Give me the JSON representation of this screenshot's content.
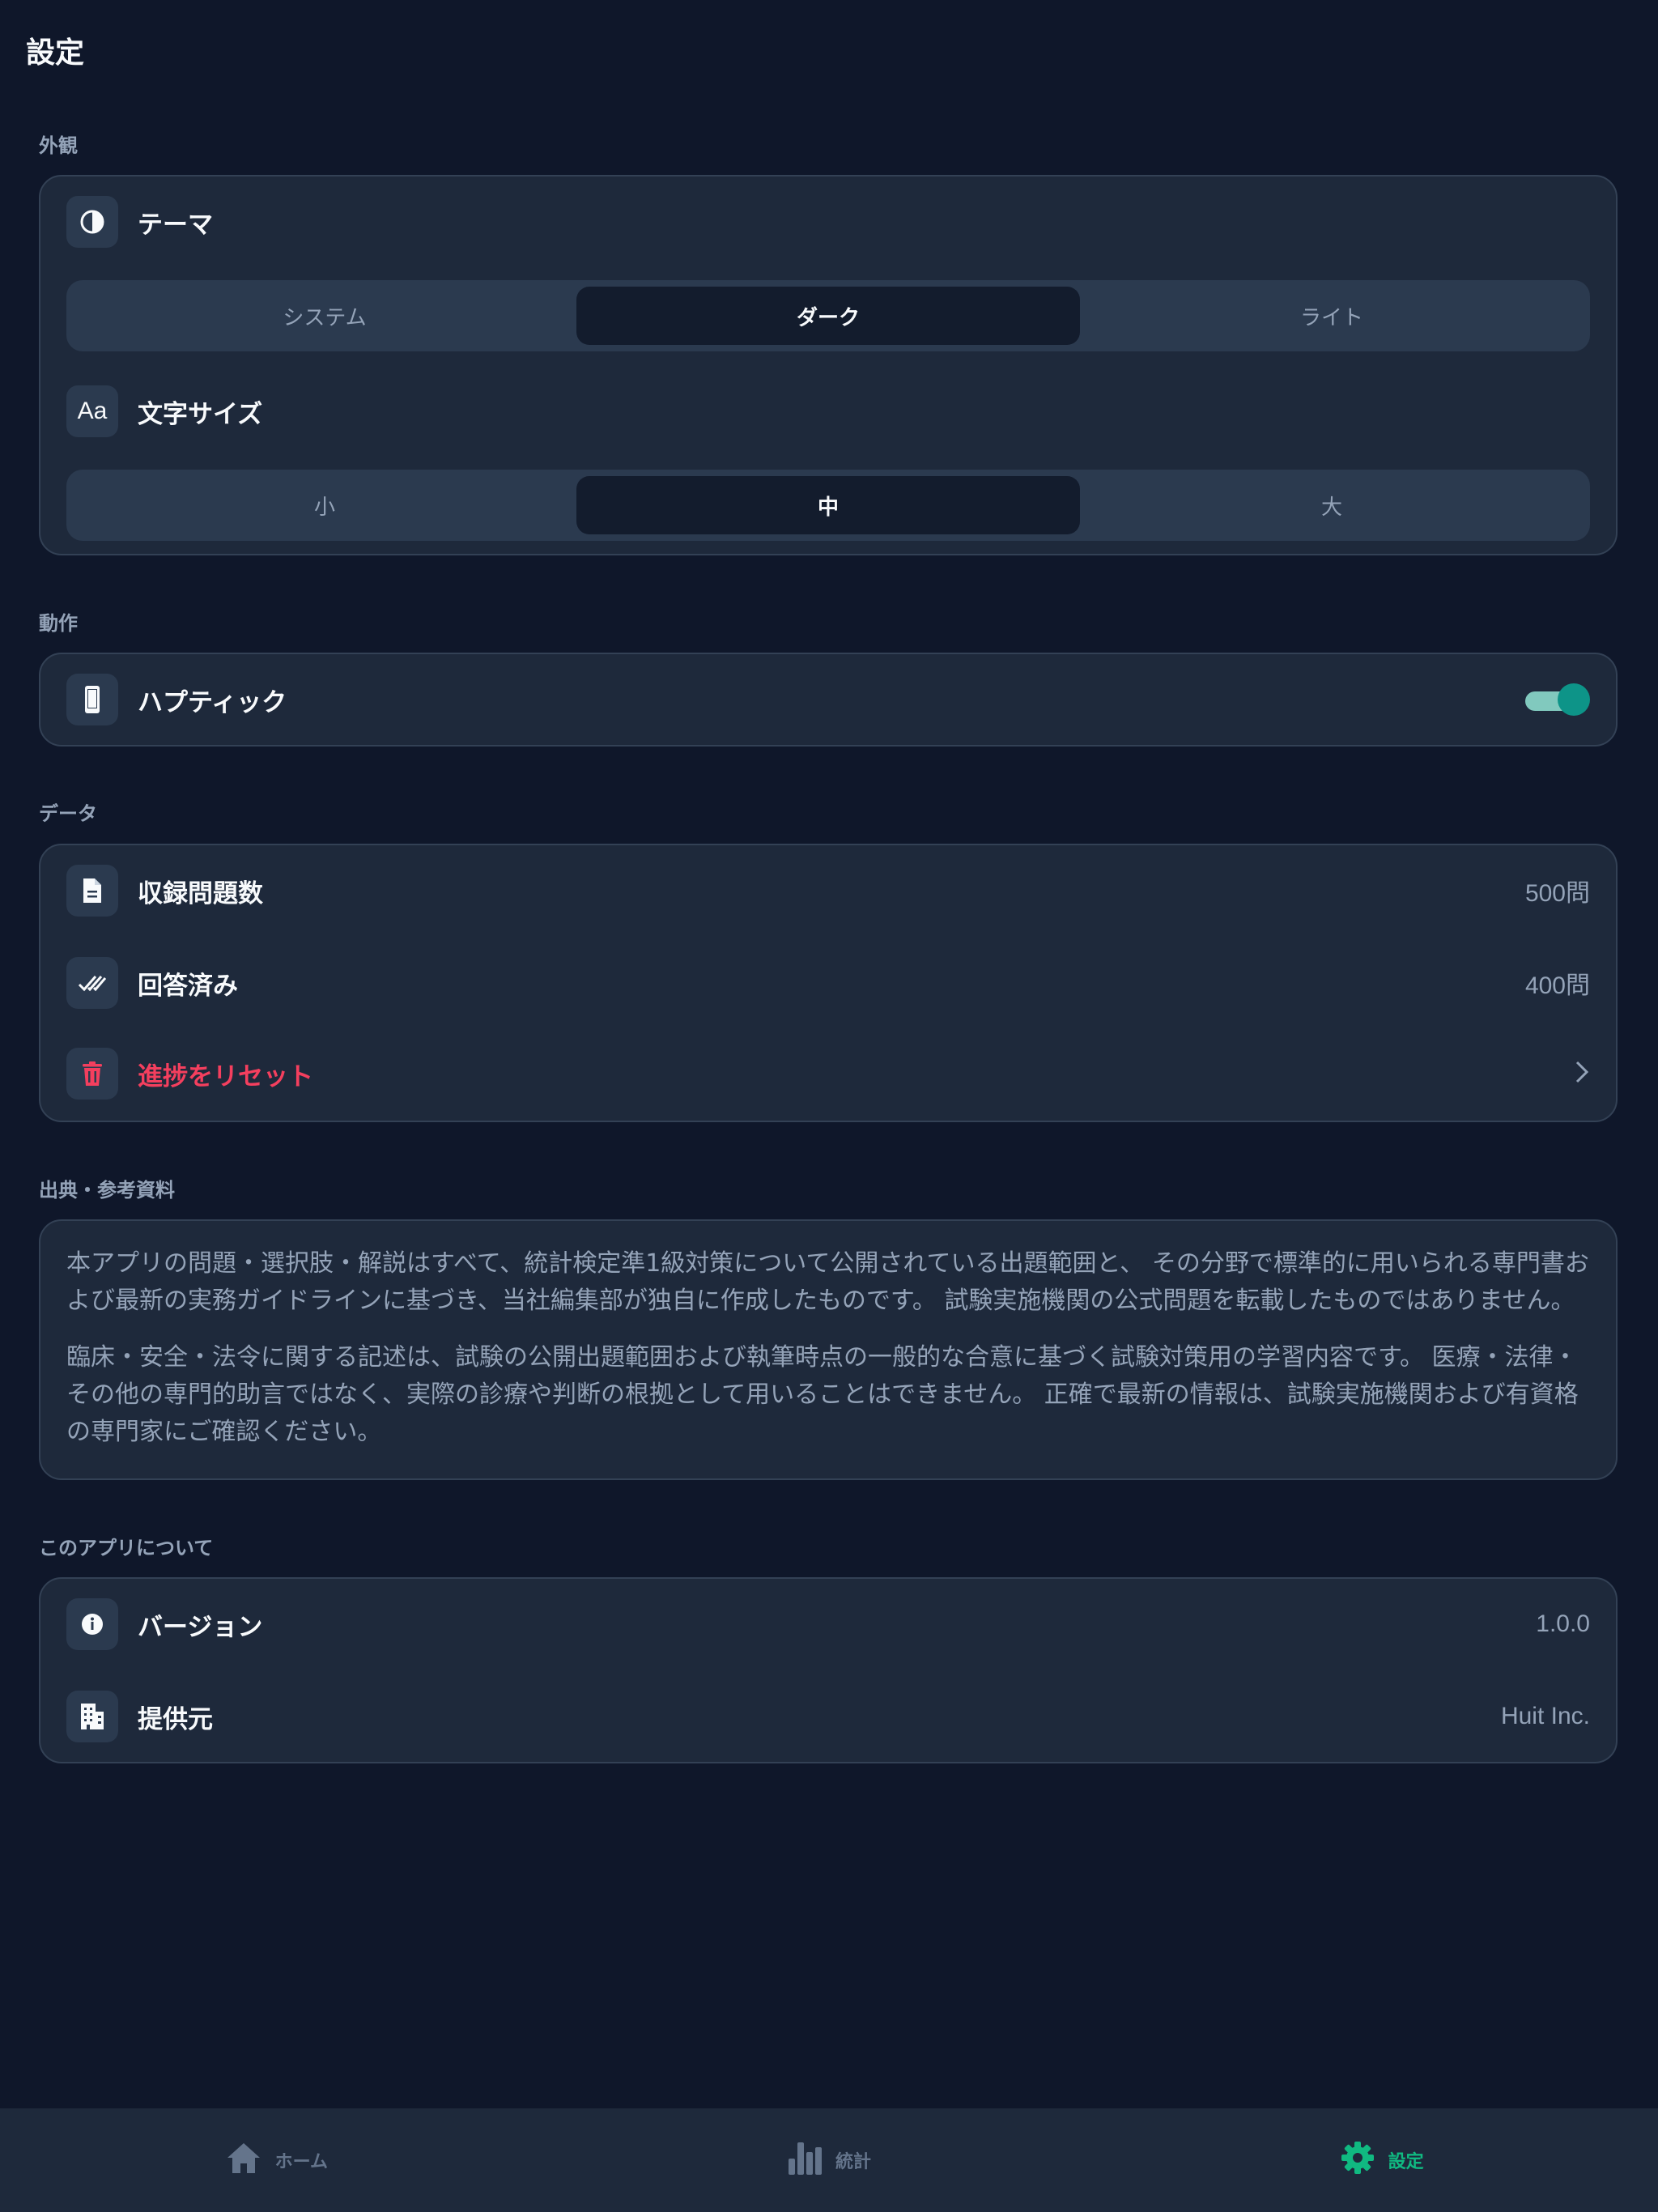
{
  "header": {
    "title": "設定"
  },
  "sections": {
    "appearance": {
      "label": "外観",
      "theme": {
        "label": "テーマ",
        "icon": "contrast-icon",
        "options": [
          "システム",
          "ダーク",
          "ライト"
        ],
        "selected": "ダーク"
      },
      "font_size": {
        "label": "文字サイズ",
        "icon_text": "Aa",
        "options": [
          "小",
          "中",
          "大"
        ],
        "selected": "中"
      }
    },
    "behavior": {
      "label": "動作",
      "haptic": {
        "label": "ハプティック",
        "icon": "phone-icon",
        "enabled": true
      }
    },
    "data": {
      "label": "データ",
      "total": {
        "label": "収録問題数",
        "value": "500問",
        "icon": "document-icon"
      },
      "answered": {
        "label": "回答済み",
        "value": "400問",
        "icon": "double-check-icon"
      },
      "reset": {
        "label": "進捗をリセット",
        "icon": "trash-icon",
        "color": "#f43f5e"
      }
    },
    "sources": {
      "label": "出典・参考資料",
      "paragraphs": [
        "本アプリの問題・選択肢・解説はすべて、統計検定準1級対策について公開されている出題範囲と、 その分野で標準的に用いられる専門書および最新の実務ガイドラインに基づき、当社編集部が独自に作成したものです。 試験実施機関の公式問題を転載したものではありません。",
        "臨床・安全・法令に関する記述は、試験の公開出題範囲および執筆時点の一般的な合意に基づく試験対策用の学習内容です。 医療・法律・その他の専門的助言ではなく、実際の診療や判断の根拠として用いることはできません。 正確で最新の情報は、試験実施機関および有資格の専門家にご確認ください。"
      ]
    },
    "about": {
      "label": "このアプリについて",
      "version": {
        "label": "バージョン",
        "value": "1.0.0",
        "icon": "info-icon"
      },
      "provider": {
        "label": "提供元",
        "value": "Huit Inc.",
        "icon": "building-icon"
      }
    }
  },
  "tabbar": [
    {
      "label": "ホーム",
      "icon": "home-icon",
      "active": false
    },
    {
      "label": "統計",
      "icon": "bar-chart-icon",
      "active": false
    },
    {
      "label": "設定",
      "icon": "gear-icon",
      "active": true
    }
  ],
  "colors": {
    "background": "#0f172a",
    "card": "#1e293b",
    "accent": "#10b981",
    "toggle": "#0d9488",
    "danger": "#f43f5e"
  }
}
